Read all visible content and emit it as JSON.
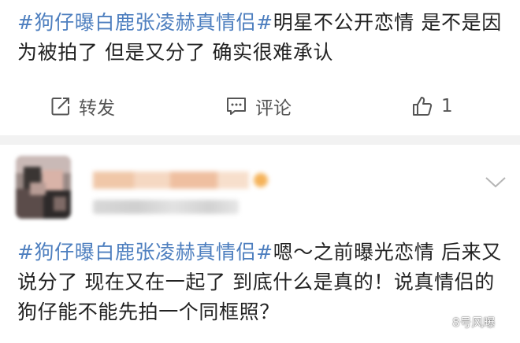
{
  "post1": {
    "hashtag": "#狗仔曝白鹿张凌赫真情侣#",
    "text": "明星不公开恋情 是不是因为被拍了 但是又分了 确实很难承认"
  },
  "actions": {
    "repost": {
      "icon": "share-icon",
      "label": "转发"
    },
    "comment": {
      "icon": "comment-icon",
      "label": "评论"
    },
    "like": {
      "icon": "thumbs-up-icon",
      "count": "1"
    }
  },
  "comment": {
    "avatar_icon": "blurred-avatar",
    "username_blurred": true,
    "hashtag": "#狗仔曝白鹿张凌赫真情侣#",
    "text": "嗯～之前曝光恋情 后来又说分了 现在又在一起了 到底什么是真的！说真情侣的狗仔能不能先拍一个同框照？",
    "menu_icon": "chevron-down-icon"
  },
  "watermark": {
    "icon": "wechat-icon",
    "text": "8号风曝"
  },
  "colors": {
    "hashtag": "#4e7fbf",
    "text": "#222222",
    "divider": "#f2f2f2",
    "action": "#555555"
  }
}
